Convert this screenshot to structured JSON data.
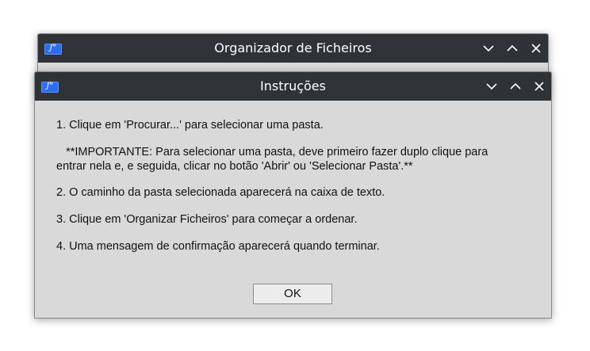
{
  "main_window": {
    "title": "Organizador de Ficheiros",
    "icon": "app-logo-icon",
    "controls": [
      "minimize-icon",
      "maximize-icon",
      "close-icon"
    ]
  },
  "dialog": {
    "title": "Instruções",
    "icon": "app-logo-icon",
    "controls": [
      "minimize-icon",
      "maximize-icon",
      "close-icon"
    ],
    "instructions": {
      "step1": "1. Clique em 'Procurar...' para selecionar uma pasta.",
      "important_line1": "   **IMPORTANTE: Para selecionar uma pasta, deve primeiro fazer duplo clique para",
      "important_line2": "entrar nela e, e seguida, clicar no botão 'Abrir' ou 'Selecionar Pasta'.**",
      "step2": "2. O caminho da pasta selecionada aparecerá na caixa de texto.",
      "step3": "3. Clique em 'Organizar Ficheiros' para começar a ordenar.",
      "step4": "4. Uma mensagem de confirmação aparecerá quando terminar."
    },
    "ok_label": "OK"
  },
  "app_icon_glyph": "ƒ°",
  "colors": {
    "titlebar": "#2f3337",
    "window_bg": "#d9d9d9",
    "icon_blue": "#2e6df2"
  }
}
